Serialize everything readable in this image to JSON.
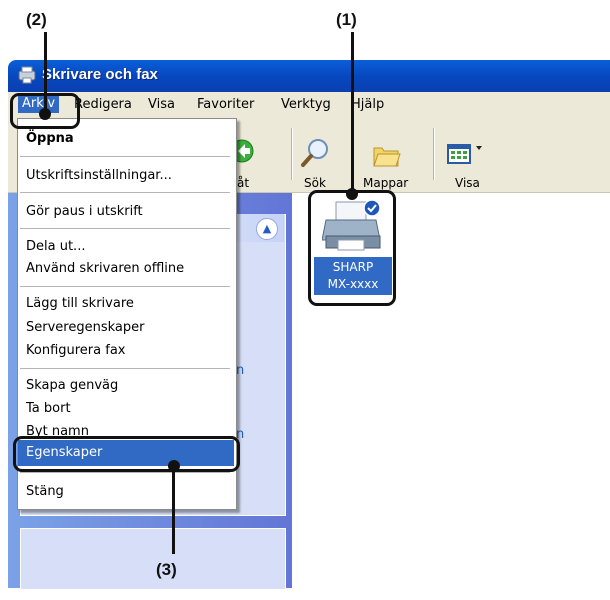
{
  "callouts": {
    "c1": "(1)",
    "c2": "(2)",
    "c3": "(3)"
  },
  "window": {
    "title": "Skrivare och fax"
  },
  "menubar": [
    "Arkiv",
    "Redigera",
    "Visa",
    "Favoriter",
    "Verktyg",
    "Hjälp"
  ],
  "toolbar": {
    "back": "åt",
    "search": "Sök",
    "folders": "Mappar",
    "view": "Visa"
  },
  "file_menu": {
    "open": "Öppna",
    "print_prefs": "Utskriftsinställningar...",
    "pause": "Gör paus i utskrift",
    "share": "Dela ut...",
    "offline": "Använd skrivaren offline",
    "add_printer": "Lägg till skrivare",
    "server_props": "Serveregenskaper",
    "config_fax": "Konfigurera fax",
    "shortcut": "Skapa genväg",
    "delete": "Ta bort",
    "rename": "Byt namn",
    "properties": "Egenskaper",
    "close": "Stäng"
  },
  "printer": {
    "line1": "SHARP",
    "line2": "MX-xxxx"
  },
  "pane_fragments": {
    "a": "n",
    "b": "n"
  },
  "colors": {
    "accent": "#316ac5",
    "titlebar": "#0a5fd8",
    "menubar": "#ece9d8"
  }
}
